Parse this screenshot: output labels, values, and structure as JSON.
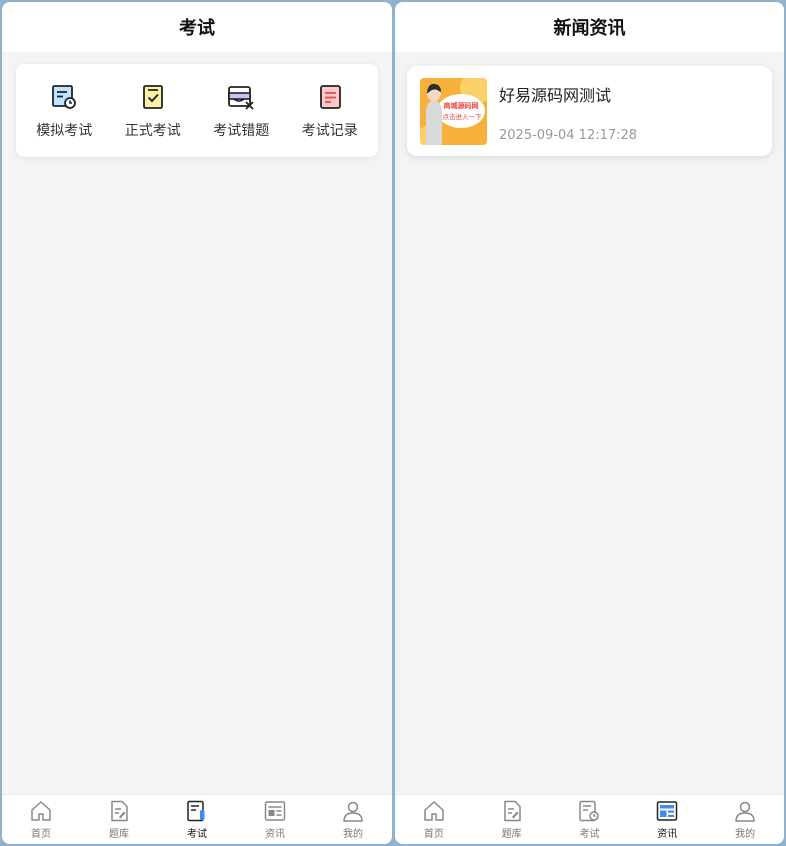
{
  "left_screen": {
    "title": "考试",
    "exam_menu": [
      {
        "label": "模拟考试",
        "icon": "mock-exam-icon"
      },
      {
        "label": "正式考试",
        "icon": "formal-exam-icon"
      },
      {
        "label": "考试错题",
        "icon": "wrong-questions-icon"
      },
      {
        "label": "考试记录",
        "icon": "exam-record-icon"
      }
    ],
    "active_tab": "考试"
  },
  "right_screen": {
    "title": "新闻资讯",
    "news": [
      {
        "title": "好易源码网测试",
        "date": "2025-09-04 12:17:28",
        "thumb_text_1": "商城源码网",
        "thumb_text_2": "点击进入一下"
      }
    ],
    "active_tab": "资讯"
  },
  "tabbar": {
    "items": [
      {
        "label": "首页",
        "icon": "home-icon"
      },
      {
        "label": "题库",
        "icon": "question-bank-icon"
      },
      {
        "label": "考试",
        "icon": "exam-icon"
      },
      {
        "label": "资讯",
        "icon": "news-icon"
      },
      {
        "label": "我的",
        "icon": "profile-icon"
      }
    ]
  },
  "colors": {
    "background": "#f4f4f4",
    "frame": "#8fb3cf",
    "accent_blue": "#3b8ef0",
    "mock_exam_fill": "#bfe3ff",
    "formal_exam_fill": "#fff1a8",
    "wrong_fill": "#c9c3f5",
    "record_fill": "#ffc8c8"
  }
}
